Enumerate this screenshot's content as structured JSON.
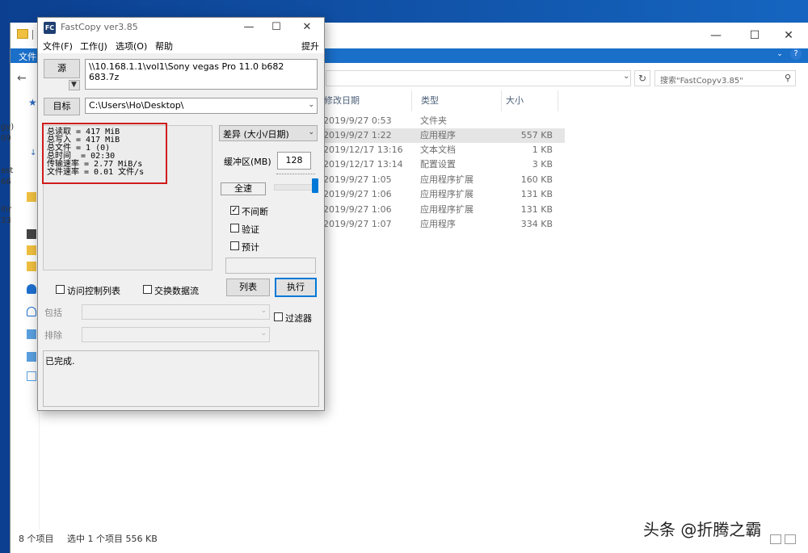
{
  "explorer": {
    "ribbon_file": "文件",
    "search_placeholder": "搜索\"FastCopyv3.85\"",
    "columns": {
      "modified": "修改日期",
      "type": "类型",
      "size": "大小"
    },
    "files": [
      {
        "date": "2019/9/27 0:53",
        "type": "文件夹",
        "size": ""
      },
      {
        "date": "2019/9/27 1:22",
        "type": "应用程序",
        "size": "557 KB"
      },
      {
        "date": "2019/12/17 13:16",
        "type": "文本文档",
        "size": "1 KB"
      },
      {
        "date": "2019/12/17 13:14",
        "type": "配置设置",
        "size": "3 KB"
      },
      {
        "date": "2019/9/27 1:05",
        "type": "应用程序扩展",
        "size": "160 KB"
      },
      {
        "date": "2019/9/27 1:06",
        "type": "应用程序扩展",
        "size": "131 KB"
      },
      {
        "date": "2019/9/27 1:06",
        "type": "应用程序扩展",
        "size": "131 KB"
      },
      {
        "date": "2019/9/27 1:07",
        "type": "应用程序",
        "size": "334 KB"
      }
    ],
    "nav_fragments": [
      "gy)",
      "09",
      "ast",
      "66",
      "ihr",
      "33"
    ],
    "status": {
      "count": "8 个项目",
      "selected": "选中 1 个项目  556 KB"
    }
  },
  "fastcopy": {
    "logo": "FC",
    "title": "FastCopy ver3.85",
    "menu": {
      "file": "文件(F)",
      "job": "工作(J)",
      "options": "选项(O)",
      "help": "帮助",
      "hint": "提升"
    },
    "source_button": "源",
    "source_path": "\\\\10.168.1.1\\vol1\\Sony vegas Pro 11.0 b682 683.7z",
    "dest_button": "目标",
    "dest_path": "C:\\Users\\Ho\\Desktop\\",
    "stats": [
      "总读取 = 417 MiB",
      "总写入 = 417 MiB",
      "总文件 = 1 (0)",
      "总时间  = 02:30",
      "传输速率 = 2.77 MiB/s",
      "文件速率 = 0.01 文件/s"
    ],
    "mode": "差异 (大小/日期)",
    "buffer_label": "缓冲区(MB)",
    "buffer_value": "128",
    "speed_label": "全速",
    "speed_level": 1.0,
    "options": [
      {
        "label": "不间断",
        "checked": true
      },
      {
        "label": "验证",
        "checked": false
      },
      {
        "label": "预计",
        "checked": false
      }
    ],
    "acl_label": "访问控制列表",
    "stream_label": "交换数据流",
    "list_button": "列表",
    "execute_button": "执行",
    "include_label": "包括",
    "exclude_label": "排除",
    "filter_label": "过滤器",
    "status_text": "已完成."
  },
  "watermark": "头条 @折腾之霸"
}
